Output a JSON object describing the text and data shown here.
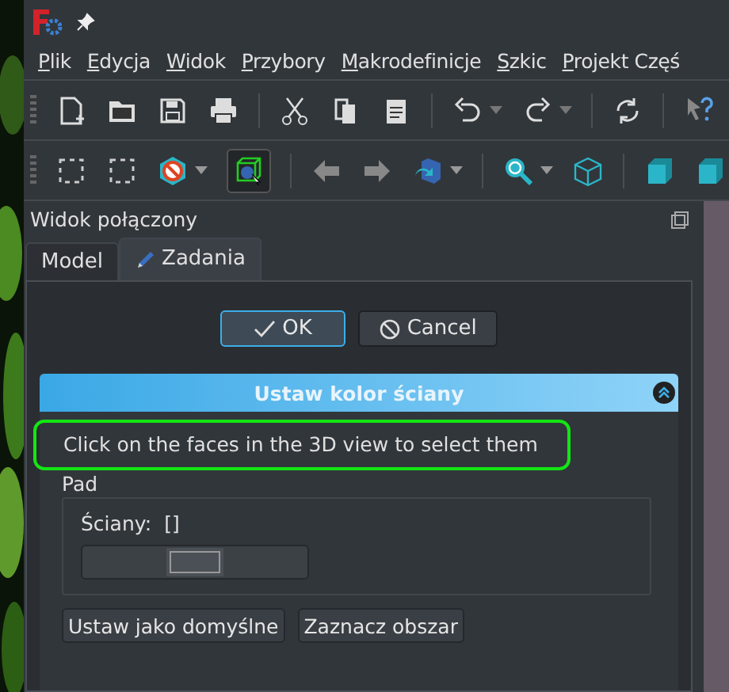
{
  "menu": [
    "Plik",
    "Edycja",
    "Widok",
    "Przybory",
    "Makrodefinicje",
    "Szkic",
    "Projekt Częś"
  ],
  "dock": {
    "title": "Widok połączony"
  },
  "tabs": [
    {
      "label": "Model",
      "selected": false,
      "icon": false
    },
    {
      "label": "Zadania",
      "selected": true,
      "icon": true
    }
  ],
  "dialog_buttons": [
    {
      "label": "OK",
      "kind": "ok",
      "focused": true
    },
    {
      "label": "Cancel",
      "kind": "cancel",
      "focused": false
    }
  ],
  "section": {
    "title": "Ustaw kolor ściany",
    "expanded": true
  },
  "hint": {
    "text": "Click on the faces in the 3D view to select them",
    "highlighted": true
  },
  "group": {
    "title": "Pad",
    "faces_label": "Ściany:",
    "faces_value": "[]"
  },
  "bottom_buttons": [
    "Ustaw jako domyślne",
    "Zaznacz obszar"
  ]
}
